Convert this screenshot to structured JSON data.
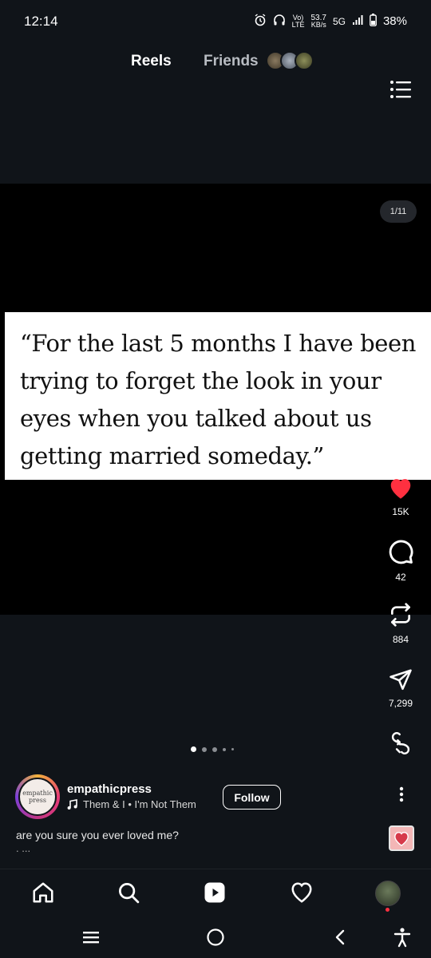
{
  "status_bar": {
    "time": "12:14",
    "network_top": "Vo)",
    "network_bottom": "LTE",
    "speed_value": "53.7",
    "speed_unit": "KB/s",
    "network_type": "5G",
    "battery": "38%"
  },
  "header": {
    "tabs": [
      {
        "label": "Reels",
        "active": true
      },
      {
        "label": "Friends",
        "active": false
      }
    ]
  },
  "post": {
    "page_counter": "1/11",
    "quote": "“For the last 5 months I have been trying to forget the look in your eyes when you talked about us getting married someday.”",
    "carousel": {
      "total_dots_visible": 5,
      "active_index": 0
    }
  },
  "actions": {
    "like_count": "15K",
    "comment_count": "42",
    "repost_count": "884",
    "share_count": "7,299",
    "liked": true,
    "like_color": "#ff3040"
  },
  "author": {
    "username": "empathicpress",
    "avatar_text": "empathic press",
    "audio": "Them & I • I'm Not Them",
    "follow_label": "Follow"
  },
  "caption": {
    "text": "are you sure you ever loved me?",
    "more": ". ..."
  },
  "bottom_nav": {
    "items": [
      "home",
      "search",
      "reels",
      "activity",
      "profile"
    ],
    "active": "reels"
  }
}
